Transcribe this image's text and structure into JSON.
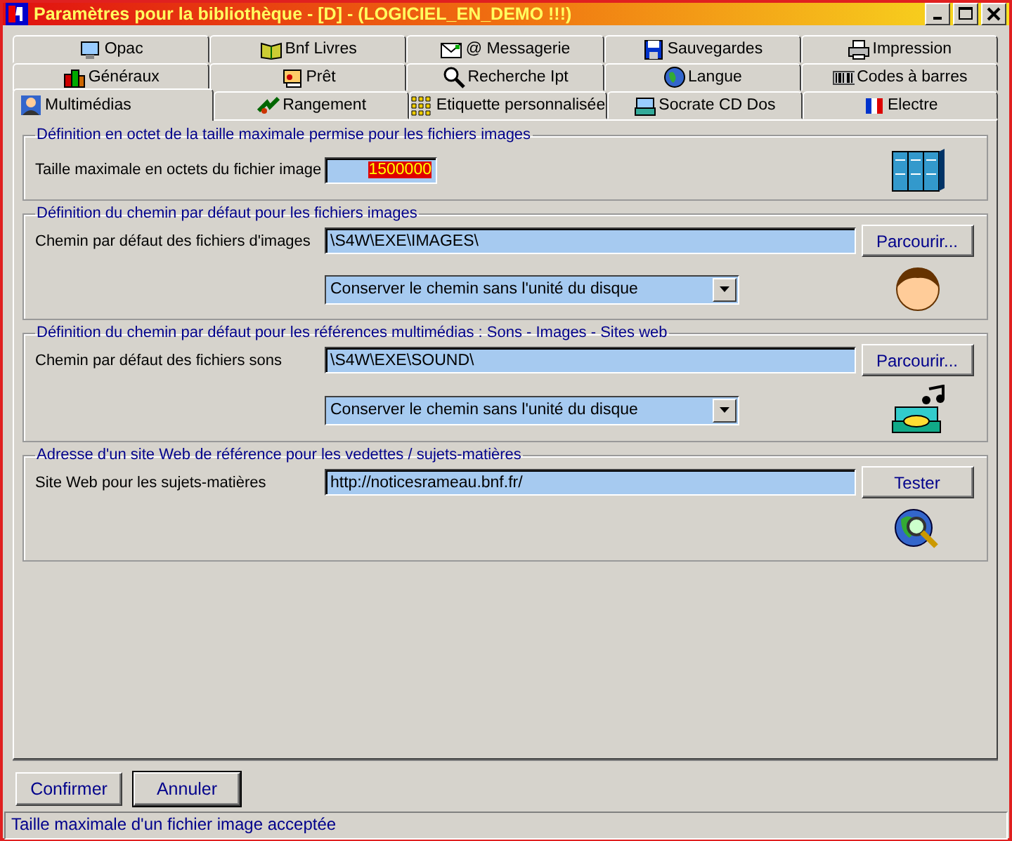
{
  "window": {
    "title": "Paramètres pour la bibliothèque - [D] - (LOGICIEL_EN_DEMO !!!)"
  },
  "tab_rows": [
    [
      {
        "label": "Opac",
        "selected": false
      },
      {
        "label": "Bnf Livres",
        "selected": false
      },
      {
        "label": "@ Messagerie",
        "selected": false
      },
      {
        "label": "Sauvegardes",
        "selected": false
      },
      {
        "label": "Impression",
        "selected": false
      }
    ],
    [
      {
        "label": "Généraux",
        "selected": false
      },
      {
        "label": "Prêt",
        "selected": false
      },
      {
        "label": "Recherche Ipt",
        "selected": false
      },
      {
        "label": "Langue",
        "selected": false
      },
      {
        "label": "Codes à barres",
        "selected": false
      }
    ],
    [
      {
        "label": "Multimédias",
        "selected": true
      },
      {
        "label": "Rangement",
        "selected": false
      },
      {
        "label": "Etiquette personnalisée",
        "selected": false
      },
      {
        "label": "Socrate CD Dos",
        "selected": false
      },
      {
        "label": "Electre",
        "selected": false
      }
    ]
  ],
  "groups": [
    {
      "legend": "Définition en octet de la taille maximale permise pour les fichiers images",
      "label": "Taille maximale en octets du fichier image",
      "field": {
        "value": "1500000",
        "text_selected": true,
        "kind": "short"
      }
    },
    {
      "legend": "Définition du chemin par défaut pour les fichiers images",
      "label": "Chemin par défaut des fichiers d'images",
      "field": {
        "value": "\\S4W\\EXE\\IMAGES\\",
        "text_selected": false,
        "kind": "long"
      },
      "button": "Parcourir...",
      "dropdown": "Conserver le chemin sans l'unité du disque"
    },
    {
      "legend": "Définition du chemin par défaut pour les références multimédias : Sons - Images - Sites web",
      "label": "Chemin par défaut des fichiers sons",
      "field": {
        "value": "\\S4W\\EXE\\SOUND\\",
        "text_selected": false,
        "kind": "long"
      },
      "button": "Parcourir...",
      "dropdown": "Conserver le chemin sans l'unité du disque"
    },
    {
      "legend": "Adresse d'un site Web de référence pour les vedettes / sujets-matières",
      "label": "Site Web pour les sujets-matières",
      "field": {
        "value": "http://noticesrameau.bnf.fr/",
        "text_selected": false,
        "kind": "long"
      },
      "button": "Tester"
    }
  ],
  "buttons": [
    "Confirmer",
    "Annuler"
  ],
  "status_bar": "Taille maximale d'un fichier image acceptée"
}
